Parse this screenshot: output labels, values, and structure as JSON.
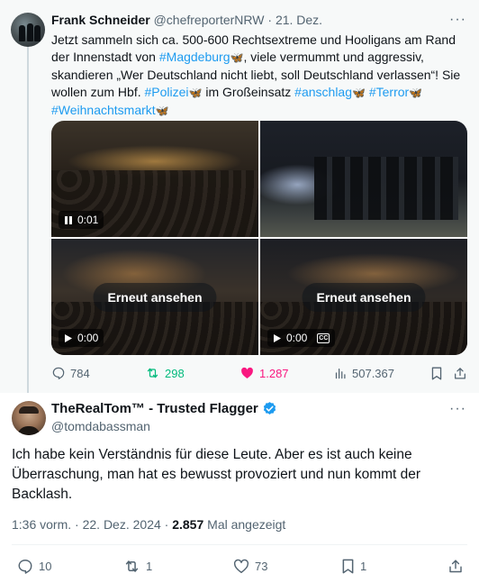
{
  "quoted": {
    "author_name": "Frank Schneider",
    "handle": "@chefreporterNRW",
    "separator": "·",
    "date": "21. Dez.",
    "more": "···",
    "text_parts": {
      "p1": "Jetzt sammeln sich ca. 500-600 Rechtsextreme und Hooligans am Rand der Innenstadt von ",
      "tag_magdeburg": "#Magdeburg",
      "p2": ", viele vermummt und aggressiv, skandieren „Wer Deutschland nicht liebt, soll Deutschland verlassen“! Sie wollen zum Hbf. ",
      "tag_polizei": "#Polizei",
      "p3": " im Großeinsatz ",
      "tag_anschlag": "#anschlag",
      "tag_terror": "#Terror",
      "tag_weihnachtsmarkt": "#Weihnachtsmarkt",
      "butterfly": "🦋"
    },
    "media": [
      {
        "time": "0:01",
        "state": "pause"
      },
      {
        "time": "",
        "state": "none"
      },
      {
        "time": "0:00",
        "state": "play",
        "replay_label": "Erneut ansehen"
      },
      {
        "time": "0:00",
        "state": "play",
        "replay_label": "Erneut ansehen",
        "cc": "CC"
      }
    ],
    "actions": {
      "replies": "784",
      "reposts": "298",
      "likes": "1.287",
      "views": "507.367"
    },
    "colors": {
      "repost": "#00ba7c",
      "like": "#f91880",
      "link": "#1d9bf0"
    }
  },
  "post": {
    "author_name": "TheRealTom™ - Trusted Flagger",
    "verified_icon": "verified-badge-icon",
    "handle": "@tomdabassman",
    "more": "···",
    "text": "Ich habe kein Verständnis für diese Leute. Aber es ist auch keine Überraschung, man hat es bewusst provoziert und nun kommt der Backlash.",
    "time": "1:36 vorm.",
    "separator": "·",
    "date": "22. Dez. 2024",
    "views_count": "2.857",
    "views_label": "Mal angezeigt",
    "actions": {
      "replies": "10",
      "reposts": "1",
      "likes": "73",
      "bookmarks": "1"
    }
  }
}
